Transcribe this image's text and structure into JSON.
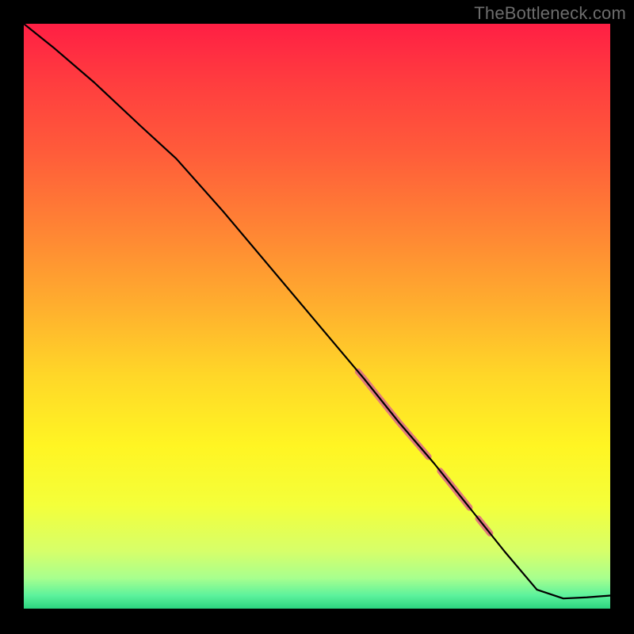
{
  "watermark": "TheBottleneck.com",
  "gradient": {
    "stops": [
      {
        "offset": 0.0,
        "color": "#ff1f44"
      },
      {
        "offset": 0.1,
        "color": "#ff3d3f"
      },
      {
        "offset": 0.22,
        "color": "#ff5c3a"
      },
      {
        "offset": 0.35,
        "color": "#ff8434"
      },
      {
        "offset": 0.48,
        "color": "#ffae2e"
      },
      {
        "offset": 0.6,
        "color": "#ffd728"
      },
      {
        "offset": 0.72,
        "color": "#fff523"
      },
      {
        "offset": 0.82,
        "color": "#f4ff3a"
      },
      {
        "offset": 0.9,
        "color": "#d6ff6a"
      },
      {
        "offset": 0.945,
        "color": "#a8ff8e"
      },
      {
        "offset": 0.975,
        "color": "#5cf29c"
      },
      {
        "offset": 1.0,
        "color": "#26d07c"
      }
    ]
  },
  "colors": {
    "line": "#000000",
    "highlight": "#e07a7a",
    "border": "#000000"
  },
  "chart_data": {
    "type": "line",
    "title": "",
    "xlabel": "",
    "ylabel": "",
    "xlim": [
      0,
      100
    ],
    "ylim": [
      0,
      100
    ],
    "grid": false,
    "legend": false,
    "series": [
      {
        "name": "curve",
        "x": [
          0,
          5,
          12,
          20,
          26,
          34,
          42,
          50,
          58,
          64,
          70,
          76,
          82,
          87.5,
          92,
          96,
          100
        ],
        "y": [
          100,
          96,
          90,
          82.5,
          77,
          68,
          58.5,
          49,
          39.5,
          32,
          25,
          17.5,
          10,
          3.5,
          2,
          2.2,
          2.5
        ]
      }
    ],
    "highlights": [
      {
        "x_start": 57,
        "x_end": 69,
        "thickness": 8
      },
      {
        "x_start": 71,
        "x_end": 76,
        "thickness": 8
      },
      {
        "x_start": 77.5,
        "x_end": 79.5,
        "thickness": 8
      }
    ]
  }
}
